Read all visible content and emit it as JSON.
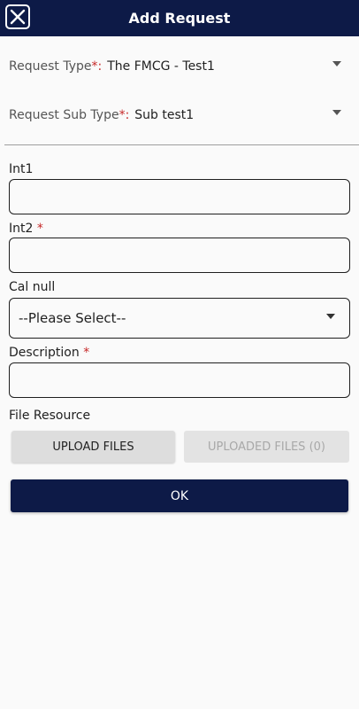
{
  "header": {
    "title": "Add Request",
    "close_icon": "close-icon"
  },
  "request_type": {
    "label": "Request Type",
    "required_mark": "*:",
    "value": "The FMCG - Test1"
  },
  "request_sub_type": {
    "label": "Request Sub Type",
    "required_mark": "*:",
    "value": "Sub test1"
  },
  "fields": {
    "int1": {
      "label": "Int1",
      "value": ""
    },
    "int2": {
      "label": "Int2",
      "required_mark": "*",
      "value": ""
    },
    "cal_null": {
      "label": "Cal null",
      "selected": "--Please Select--"
    },
    "description": {
      "label": "Description",
      "required_mark": "*",
      "value": ""
    }
  },
  "file_resource": {
    "label": "File Resource",
    "upload_label": "UPLOAD FILES",
    "uploaded_label": "UPLOADED FILES (0)"
  },
  "actions": {
    "ok_label": "OK"
  },
  "colors": {
    "primary": "#0d1a47",
    "required": "#c62828",
    "background": "#fafafa"
  }
}
